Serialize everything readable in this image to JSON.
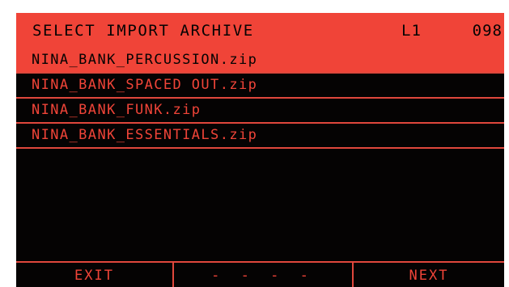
{
  "header": {
    "title": "SELECT IMPORT ARCHIVE",
    "layer": "L1",
    "counter": "098"
  },
  "files": [
    {
      "name": "NINA_BANK_PERCUSSION.zip",
      "selected": true
    },
    {
      "name": "NINA_BANK_SPACED OUT.zip",
      "selected": false
    },
    {
      "name": "NINA_BANK_FUNK.zip",
      "selected": false
    },
    {
      "name": "NINA_BANK_ESSENTIALS.zip",
      "selected": false
    }
  ],
  "footer": {
    "left": "EXIT",
    "center": "- - - -",
    "right": "NEXT"
  },
  "colors": {
    "accent": "#f04438",
    "background": "#050303"
  }
}
